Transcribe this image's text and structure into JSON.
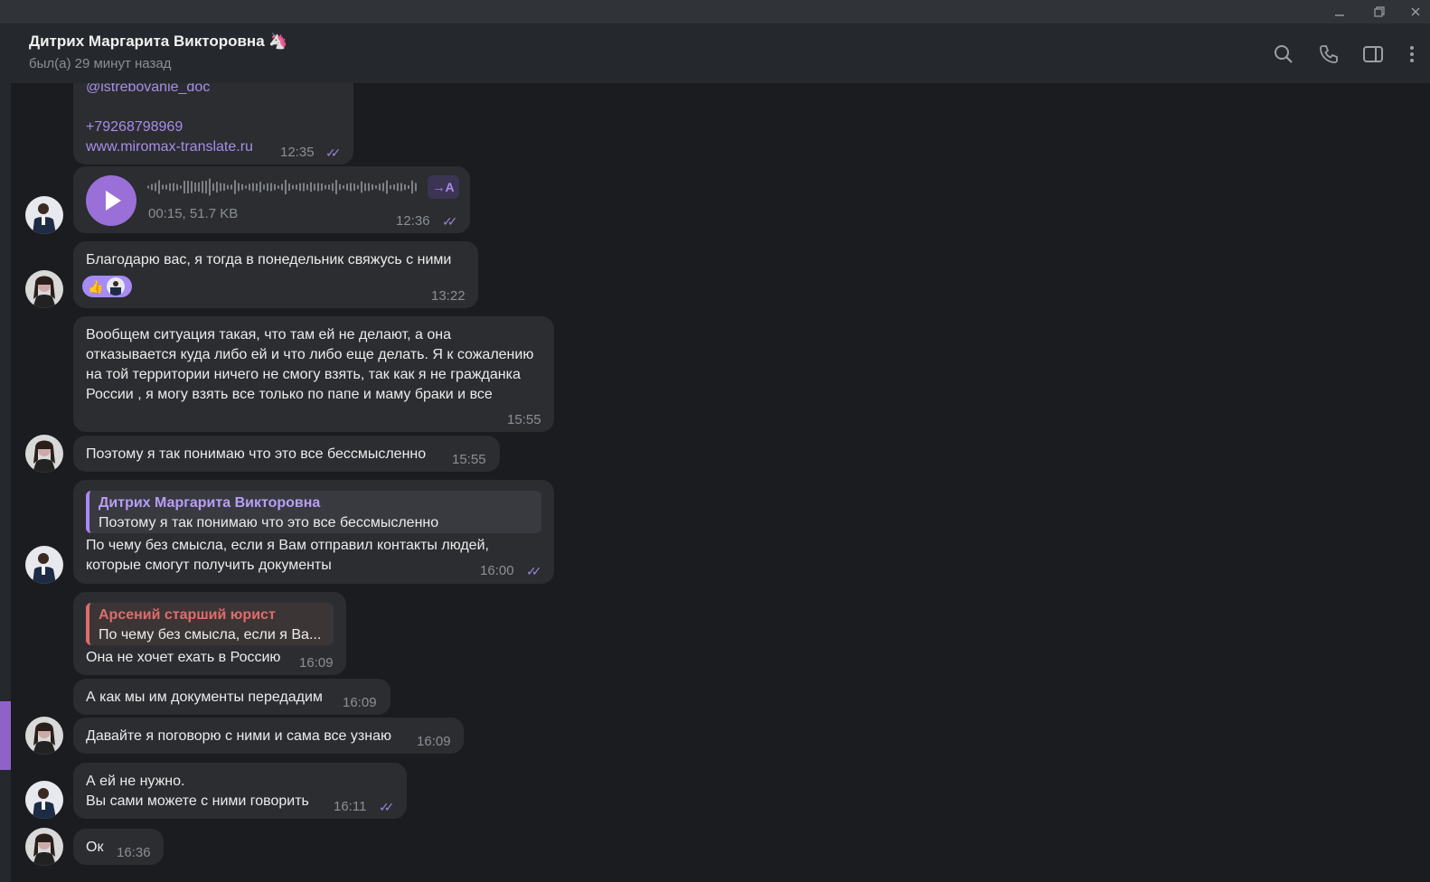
{
  "window": {
    "minimize_icon": "minimize-icon",
    "restore_icon": "restore-icon",
    "close_icon": "close-icon"
  },
  "header": {
    "name": "Дитрих Маргарита Викторовна",
    "name_emoji": "🦄",
    "status": "был(а) 29 минут назад",
    "icons": [
      "search-icon",
      "phone-icon",
      "sidebar-toggle-icon",
      "more-icon"
    ]
  },
  "messages": {
    "m1": {
      "handle": "@istrebovanie_doc",
      "phone": "+79268798969",
      "site": "www.miromax-translate.ru",
      "time": "12:35"
    },
    "m2": {
      "duration": "00:15, 51.7 KB",
      "time": "12:36",
      "transcribe": "→A"
    },
    "m3": {
      "text": "Благодарю вас, я тогда в понедельник свяжусь с ними",
      "reaction": "👍",
      "time": "13:22"
    },
    "m4": {
      "text": "Вообщем ситуация такая, что там ей не делают, а она отказывается куда либо ей и что либо еще делать. Я к сожалению на той территории ничего не смогу взять, так как я не гражданка России , я могу взять все только по папе и маму браки и все",
      "time": "15:55"
    },
    "m5": {
      "text": "Поэтому я так понимаю что это все бессмысленно",
      "time": "15:55"
    },
    "m6": {
      "quote_name": "Дитрих Маргарита Викторовна",
      "quote_text": "Поэтому я так понимаю что это все бессмысленно",
      "text": "По чему без смысла, если я Вам отправил контакты людей, которые смогут получить документы",
      "time": "16:00"
    },
    "m7": {
      "quote_name": "Арсений старший юрист",
      "quote_text": "По чему без смысла, если я Ва...",
      "text": "Она не хочет ехать в Россию",
      "time": "16:09"
    },
    "m8": {
      "text": "А как мы им документы передадим",
      "time": "16:09"
    },
    "m9": {
      "text": "Давайте я поговорю с ними и сама все узнаю",
      "time": "16:09"
    },
    "m10": {
      "line1": "А ей не нужно.",
      "line2": "Вы сами можете с ними говорить",
      "time": "16:11"
    },
    "m11": {
      "text": "Ок",
      "time": "16:36"
    }
  },
  "colors": {
    "accent": "#8e63c8",
    "bubble": "#2b2d31",
    "background": "#1b1c1f",
    "link": "#a88ee6",
    "quote_red": "#e06c6c"
  }
}
